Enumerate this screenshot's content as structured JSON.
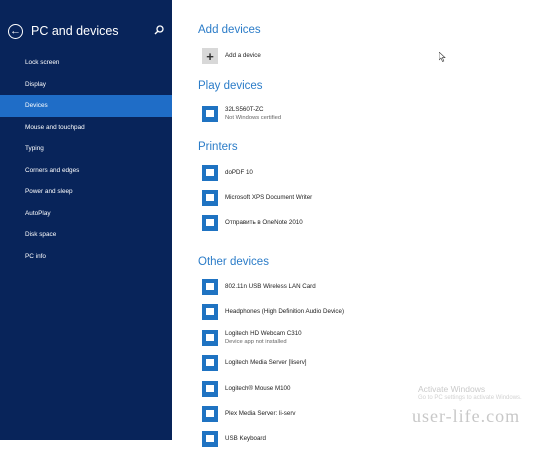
{
  "sidebar": {
    "title": "PC and devices",
    "items": [
      {
        "label": "Lock screen",
        "active": false
      },
      {
        "label": "Display",
        "active": false
      },
      {
        "label": "Devices",
        "active": true
      },
      {
        "label": "Mouse and touchpad",
        "active": false
      },
      {
        "label": "Typing",
        "active": false
      },
      {
        "label": "Corners and edges",
        "active": false
      },
      {
        "label": "Power and sleep",
        "active": false
      },
      {
        "label": "AutoPlay",
        "active": false
      },
      {
        "label": "Disk space",
        "active": false
      },
      {
        "label": "PC info",
        "active": false
      }
    ]
  },
  "sections": {
    "add": {
      "title": "Add devices",
      "button": "Add a device"
    },
    "play": {
      "title": "Play devices",
      "devices": [
        {
          "name": "32LS560T-ZC",
          "sub": "Not Windows certified"
        }
      ]
    },
    "printers": {
      "title": "Printers",
      "devices": [
        {
          "name": "doPDF 10"
        },
        {
          "name": "Microsoft XPS Document Writer"
        },
        {
          "name": "Отправить в OneNote 2010"
        }
      ]
    },
    "other": {
      "title": "Other devices",
      "devices": [
        {
          "name": "802.11n USB Wireless LAN Card"
        },
        {
          "name": "Headphones (High Definition Audio Device)"
        },
        {
          "name": "Logitech HD Webcam C310",
          "sub": "Device app not installed"
        },
        {
          "name": "Logitech Media Server [liserv]"
        },
        {
          "name": "Logitech® Mouse M100"
        },
        {
          "name": "Plex Media Server: li-serv"
        },
        {
          "name": "USB Keyboard"
        }
      ]
    }
  },
  "watermark": {
    "line1": "Activate Windows",
    "line2": "Go to PC settings to activate Windows.",
    "brand": "user-life.com"
  },
  "colors": {
    "sidebar": "#08245a",
    "active": "#1f6dc7",
    "accent": "#2b7cc8"
  }
}
